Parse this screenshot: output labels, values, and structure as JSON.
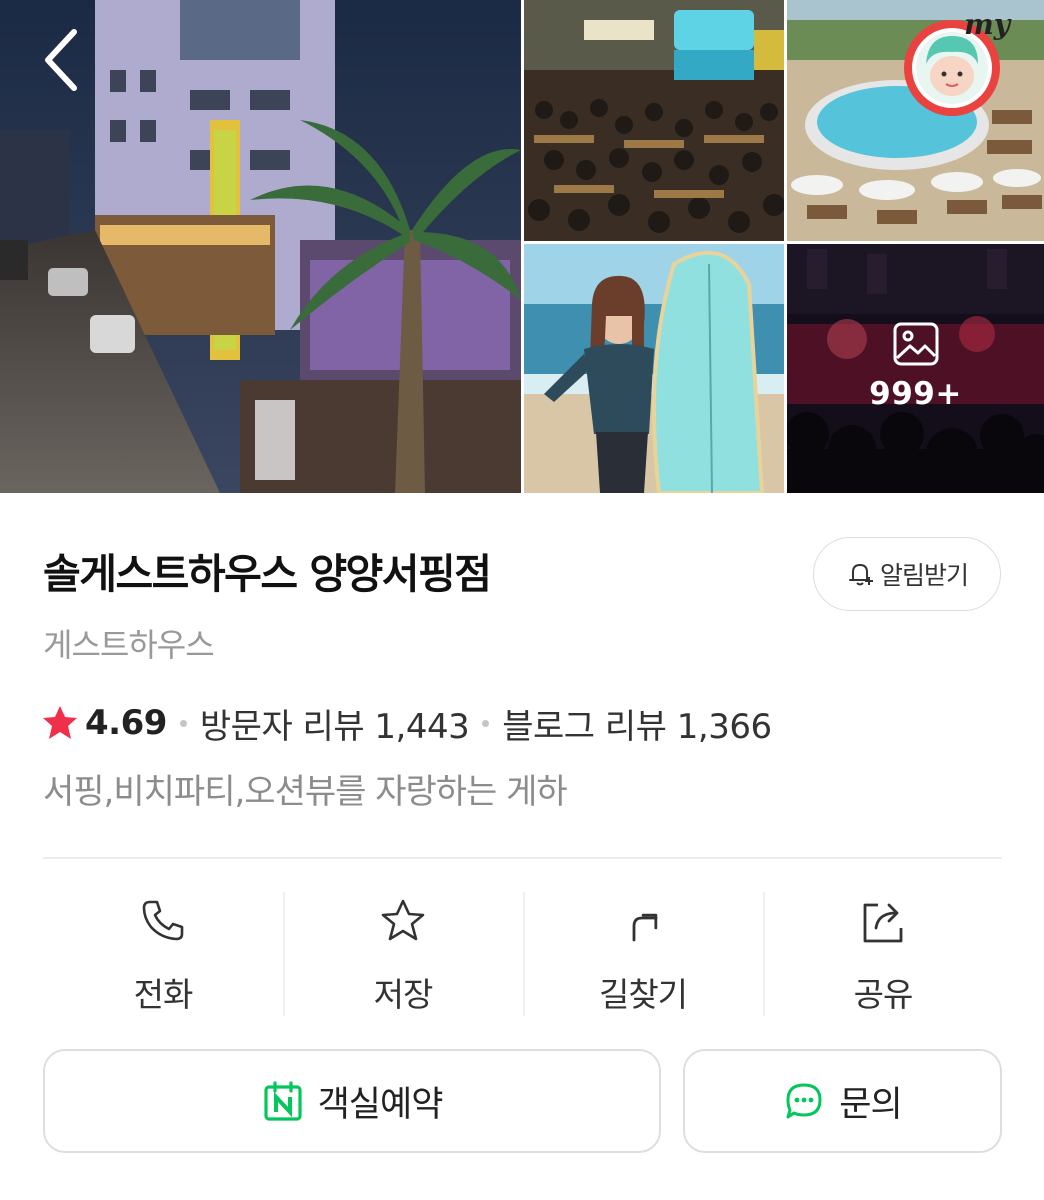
{
  "header": {
    "back_icon": "chevron-left-icon"
  },
  "gallery": {
    "more_count": "999+",
    "my_badge_text": "my",
    "photos": [
      "street-night",
      "crowd-party",
      "pool",
      "surfer",
      "concert"
    ]
  },
  "place": {
    "title": "솔게스트하우스 양양서핑점",
    "category": "게스트하우스",
    "notify_label": "알림받기",
    "rating": "4.69",
    "visitor_reviews": "방문자 리뷰 1,443",
    "blog_reviews": "블로그 리뷰 1,366",
    "description": "서핑,비치파티,오션뷰를 자랑하는 게하"
  },
  "actions": [
    {
      "label": "전화",
      "icon": "phone-icon"
    },
    {
      "label": "저장",
      "icon": "star-outline-icon"
    },
    {
      "label": "길찾기",
      "icon": "directions-icon"
    },
    {
      "label": "공유",
      "icon": "share-icon"
    }
  ],
  "buttons": {
    "reserve_label": "객실예약",
    "inquiry_label": "문의"
  },
  "colors": {
    "star": "#f0304a",
    "naver_green": "#03c75a",
    "text_primary": "#111111",
    "text_secondary": "#999999"
  }
}
